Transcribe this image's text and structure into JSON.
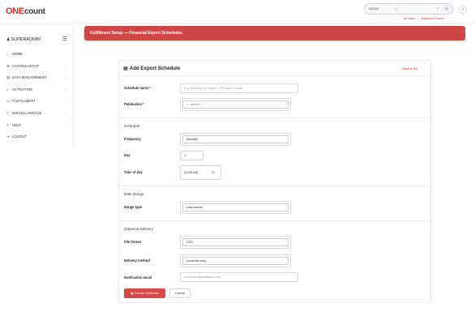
{
  "brand": {
    "logo_accent": "ONE",
    "logo_rest": "count",
    "accent_color": "#d0342c"
  },
  "search": {
    "scope": "GOOD",
    "placeholder": "",
    "clear": "✓",
    "icon": "search-icon"
  },
  "top_links": {
    "left": "All Users",
    "sep": "|",
    "right": "Advanced Search"
  },
  "sidebar": {
    "user": "SUPERADMIN",
    "items": [
      {
        "label": "HOME",
        "icon": "home-icon",
        "glyph": "⌂",
        "chevron": ""
      },
      {
        "label": "SYSTEM SETUP",
        "icon": "gear-icon",
        "glyph": "⚙",
        "chevron": "›"
      },
      {
        "label": "DATA MANAGEMENT",
        "icon": "database-icon",
        "glyph": "▤",
        "chevron": "›"
      },
      {
        "label": "ACTIVATION",
        "icon": "toggle-icon",
        "glyph": "◐",
        "chevron": "›"
      },
      {
        "label": "FULFILLMENT",
        "icon": "card-icon",
        "glyph": "▭",
        "chevron": "›"
      },
      {
        "label": "MISCELLANEOUS",
        "icon": "file-icon",
        "glyph": "▯",
        "chevron": "›"
      },
      {
        "label": "HELP",
        "icon": "question-icon",
        "glyph": "?",
        "chevron": "›"
      },
      {
        "label": "LOGOUT",
        "icon": "logout-icon",
        "glyph": "⇥",
        "chevron": ""
      }
    ]
  },
  "banner": {
    "title": "Fulfillment Setup — Financial Export Schedules"
  },
  "card": {
    "title": "Add Export Schedule",
    "back_link": "← Back to list",
    "fields": {
      "schedule_name": {
        "label": "Schedule name *",
        "placeholder": "e.g. Monthly GL Export - Reader's Guide"
      },
      "publication": {
        "label": "Publication *",
        "value": "— select —"
      },
      "frequency": {
        "label": "Frequency",
        "value": "Monthly"
      },
      "day": {
        "label": "Day",
        "value": "1"
      },
      "time_of_day": {
        "label": "Time of day",
        "value": "02:00 AM"
      },
      "range_type": {
        "label": "Range type",
        "value": "Last month"
      },
      "file_format": {
        "label": "File format",
        "value": "CSV"
      },
      "delivery_method": {
        "label": "Delivery method",
        "value": "Local file only"
      },
      "notification_email": {
        "label": "Notification email",
        "placeholder": "controller@publisher.com"
      }
    },
    "sections": {
      "schedule": "Schedule",
      "date_range": "Date Range",
      "output": "Output & Delivery"
    },
    "buttons": {
      "create": "Create Schedule",
      "cancel": "Cancel"
    }
  }
}
